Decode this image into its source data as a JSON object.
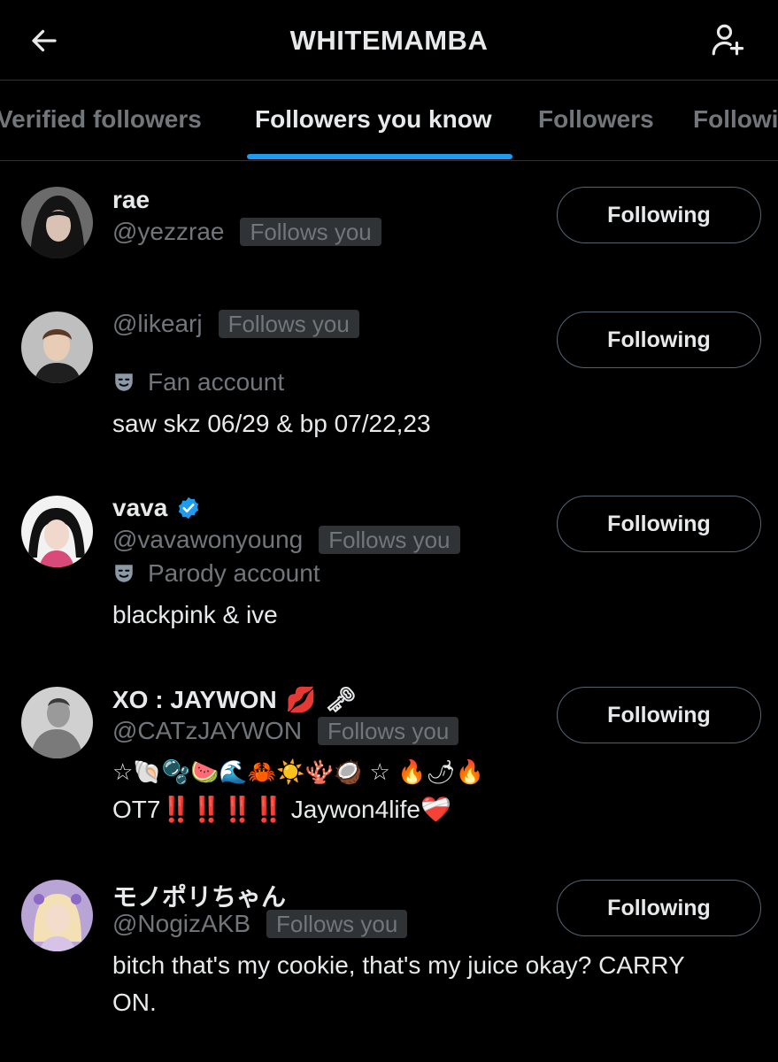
{
  "header": {
    "title": "WHITEMAMBA",
    "back_icon": "arrow-left-icon",
    "add_icon": "add-user-icon"
  },
  "tabs": [
    {
      "label": "Verified followers"
    },
    {
      "label": "Followers you know"
    },
    {
      "label": "Followers"
    },
    {
      "label": "Following"
    }
  ],
  "users": [
    {
      "name": "rae",
      "handle": "@yezzrae",
      "badge": "Follows you",
      "button": "Following"
    },
    {
      "handle": "@likearj",
      "badge": "Follows you",
      "label": "Fan account",
      "bio": "saw skz 06/29 & bp 07/22,23",
      "button": "Following"
    },
    {
      "name": "vava",
      "handle": "@vavawonyoung",
      "badge": "Follows you",
      "label": "Parody account",
      "bio": "blackpink & ive",
      "button": "Following"
    },
    {
      "name": "XO : JAYWON",
      "name_emoji": "💋 🗝",
      "handle": "@CATzJAYWON",
      "badge": "Follows you",
      "bio": "☆🐚🫧🍉🌊🦀☀️🪸🥥 ☆ 🔥🌶🔥",
      "bio2": "OT7‼️‼️‼️‼️ Jaywon4life❤️‍🩹",
      "button": "Following"
    },
    {
      "name": "モノポリちゃん",
      "handle": "@NogizAKB",
      "badge": "Follows you",
      "bio": "bitch that's my cookie, that's my juice okay? CARRY",
      "bio2": "ON.",
      "button": "Following"
    }
  ],
  "colors": {
    "background": "#000000",
    "text": "#e7e9ea",
    "muted": "#71767b",
    "accent": "#1d9bf0",
    "border": "#2f3336"
  }
}
